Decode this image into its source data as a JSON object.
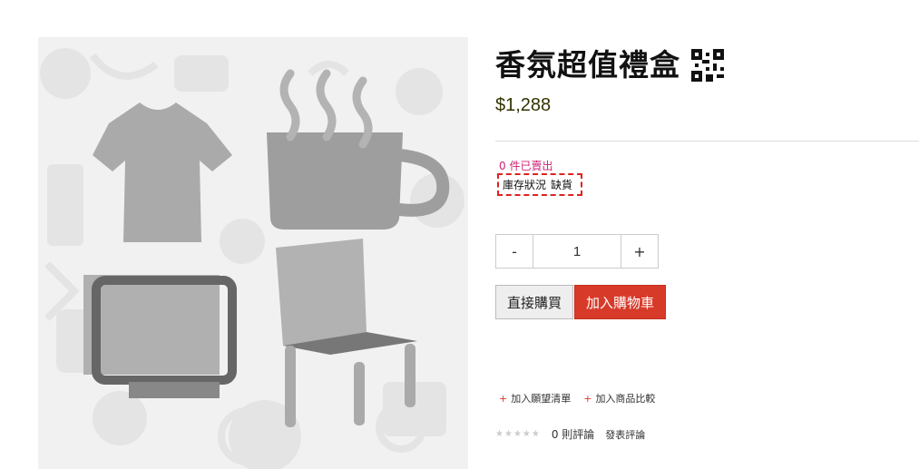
{
  "product": {
    "title": "香氛超值禮盒",
    "price": "$1,288",
    "sold_count": "0 件已賣出",
    "stock_label": "庫存狀況",
    "stock_status": "缺貨"
  },
  "quantity": {
    "decrement": "-",
    "value": "1",
    "increment": "+"
  },
  "actions": {
    "buy_now": "直接購買",
    "add_to_cart": "加入購物車"
  },
  "links": {
    "wishlist": "加入願望清單",
    "compare": "加入商品比較"
  },
  "reviews": {
    "stars": [
      "★",
      "★",
      "★",
      "★",
      "★"
    ],
    "count": "0 則評論",
    "write": "發表評論"
  },
  "icons": {
    "qr": "qr-code-icon",
    "placeholder": "product-placeholder-image"
  },
  "colors": {
    "price": "#333300",
    "sold": "#cc2277",
    "accent": "#d83a2a",
    "stock_highlight": "#dd2222"
  }
}
